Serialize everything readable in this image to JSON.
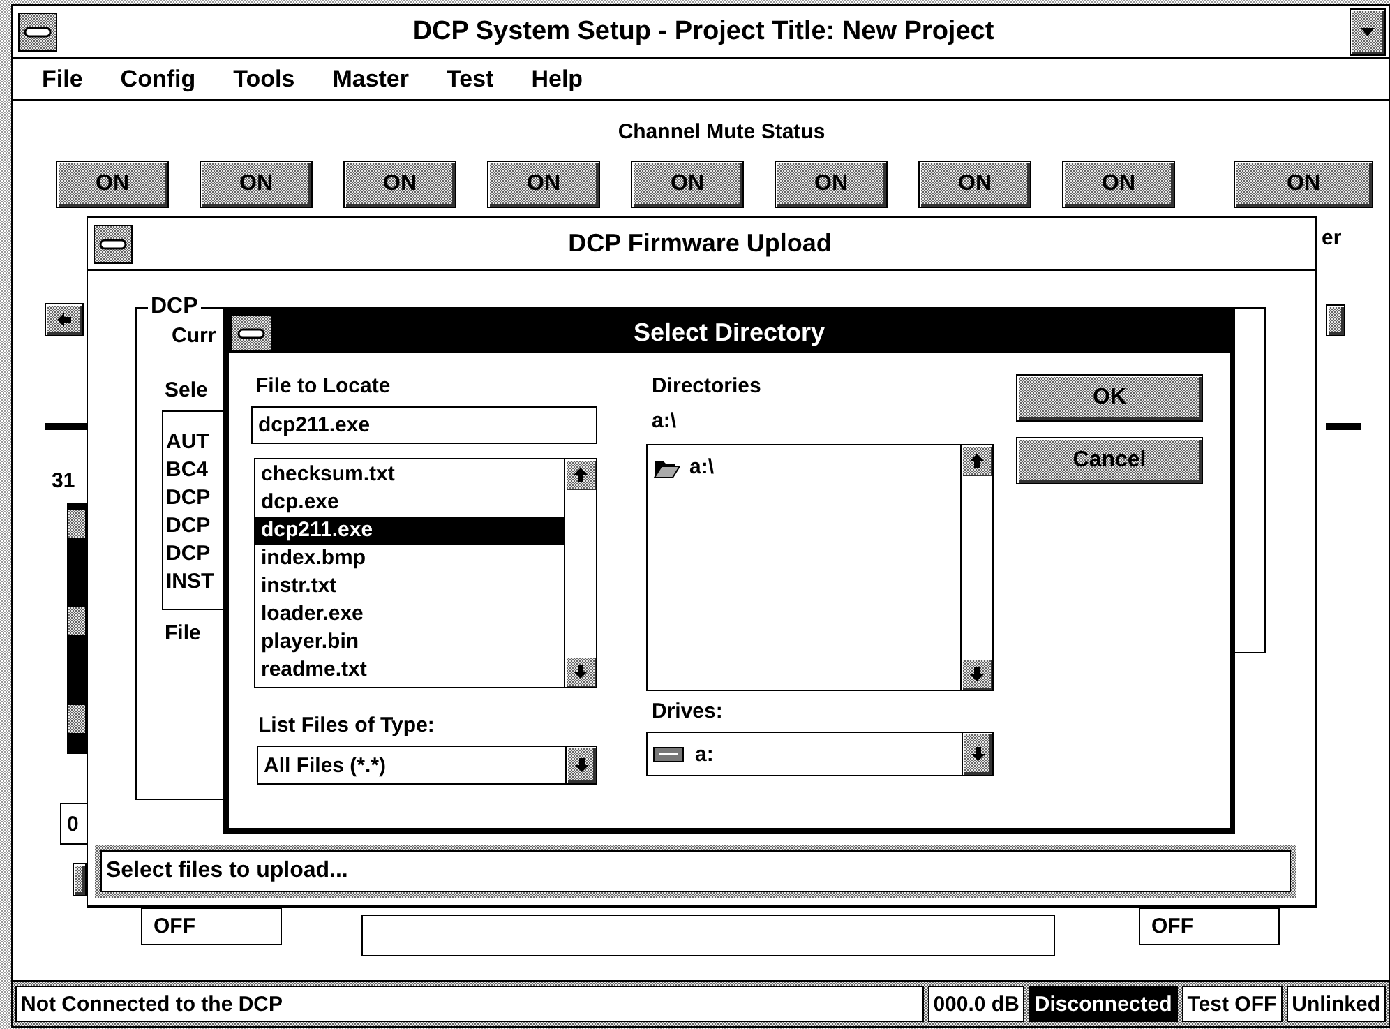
{
  "main_window": {
    "title": "DCP System Setup - Project Title: New Project",
    "menu": [
      "File",
      "Config",
      "Tools",
      "Master",
      "Test",
      "Help"
    ],
    "mute_title": "Channel Mute Status",
    "mute_buttons": [
      "ON",
      "ON",
      "ON",
      "ON",
      "ON",
      "ON",
      "ON",
      "ON",
      "ON"
    ],
    "partial_label": "er",
    "readout": "31",
    "level_box": "0",
    "left_value": "OFF",
    "right_value": "OFF",
    "status_bar": [
      {
        "text": "Not Connected to the DCP",
        "highlighted": false
      },
      {
        "text": "000.0 dB",
        "highlighted": false
      },
      {
        "text": "Disconnected",
        "highlighted": true
      },
      {
        "text": "Test OFF",
        "highlighted": false
      },
      {
        "text": "Unlinked",
        "highlighted": false
      }
    ]
  },
  "firmware_window": {
    "title": "DCP Firmware Upload",
    "group_label": "DCP",
    "current_label": "Curr",
    "select_label": "Sele",
    "files": [
      "AUT",
      "BC4",
      "DCP",
      "DCP",
      "DCP",
      "INST"
    ],
    "file_label": "File",
    "status_text": "Select files to upload..."
  },
  "select_directory": {
    "title": "Select Directory",
    "file_label": "File to Locate",
    "file_name": "dcp211.exe",
    "files": [
      {
        "name": "checksum.txt",
        "selected": false
      },
      {
        "name": "dcp.exe",
        "selected": false
      },
      {
        "name": "dcp211.exe",
        "selected": true
      },
      {
        "name": "index.bmp",
        "selected": false
      },
      {
        "name": "instr.txt",
        "selected": false
      },
      {
        "name": "loader.exe",
        "selected": false
      },
      {
        "name": "player.bin",
        "selected": false
      },
      {
        "name": "readme.txt",
        "selected": false
      }
    ],
    "type_label": "List Files of Type:",
    "type_value": "All Files (*.*)",
    "directories_label": "Directories",
    "current_path": "a:\\",
    "directories": [
      "a:\\"
    ],
    "drives_label": "Drives:",
    "drive": "a:",
    "buttons": [
      "OK",
      "Cancel"
    ]
  }
}
